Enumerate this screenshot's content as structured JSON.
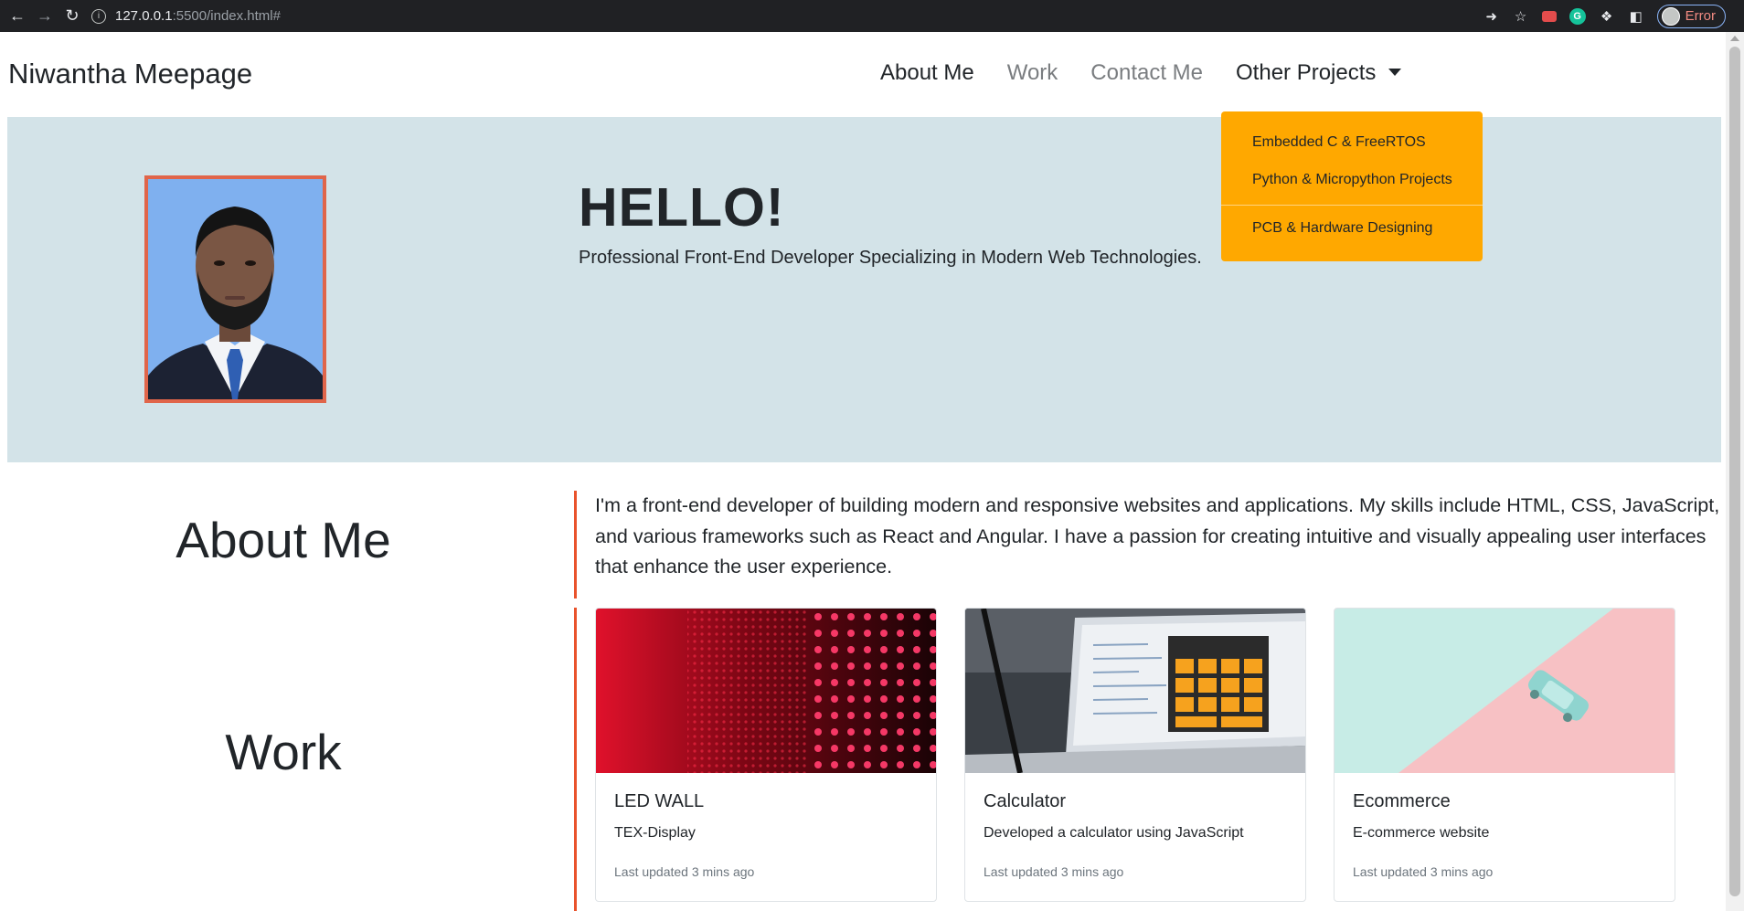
{
  "browser": {
    "url_host": "127.0.0.1",
    "url_path": ":5500/index.html#",
    "profile_label": "Error"
  },
  "navbar": {
    "brand": "Niwantha Meepage",
    "links": [
      {
        "label": "About Me",
        "state": "active"
      },
      {
        "label": "Work",
        "state": "muted"
      },
      {
        "label": "Contact Me",
        "state": "muted"
      },
      {
        "label": "Other Projects",
        "state": "active"
      }
    ],
    "dropdown": {
      "items": [
        "Embedded C & FreeRTOS",
        "Python & Micropython Projects",
        "PCB & Hardware Designing"
      ],
      "background": "#ffa800"
    }
  },
  "hero": {
    "heading": "HELLO!",
    "subheading": "Professional Front-End Developer Specializing in Modern Web Technologies."
  },
  "about": {
    "title": "About Me",
    "text": "I'm a front-end developer of building modern and responsive websites and applications. My skills include HTML, CSS, JavaScript, and various frameworks such as React and Angular. I have a passion for creating intuitive and visually appealing user interfaces that enhance the user experience."
  },
  "work": {
    "title": "Work",
    "cards": [
      {
        "title": "LED WALL",
        "text": "TEX-Display",
        "updated": "Last updated 3 mins ago"
      },
      {
        "title": "Calculator",
        "text": "Developed a calculator using JavaScript",
        "updated": "Last updated 3 mins ago"
      },
      {
        "title": "Ecommerce",
        "text": "E-commerce website",
        "updated": "Last updated 3 mins ago"
      }
    ]
  },
  "colors": {
    "hero_bg": "#d3e3e8",
    "accent_line": "#e9532c",
    "photo_border": "#e0654a"
  }
}
